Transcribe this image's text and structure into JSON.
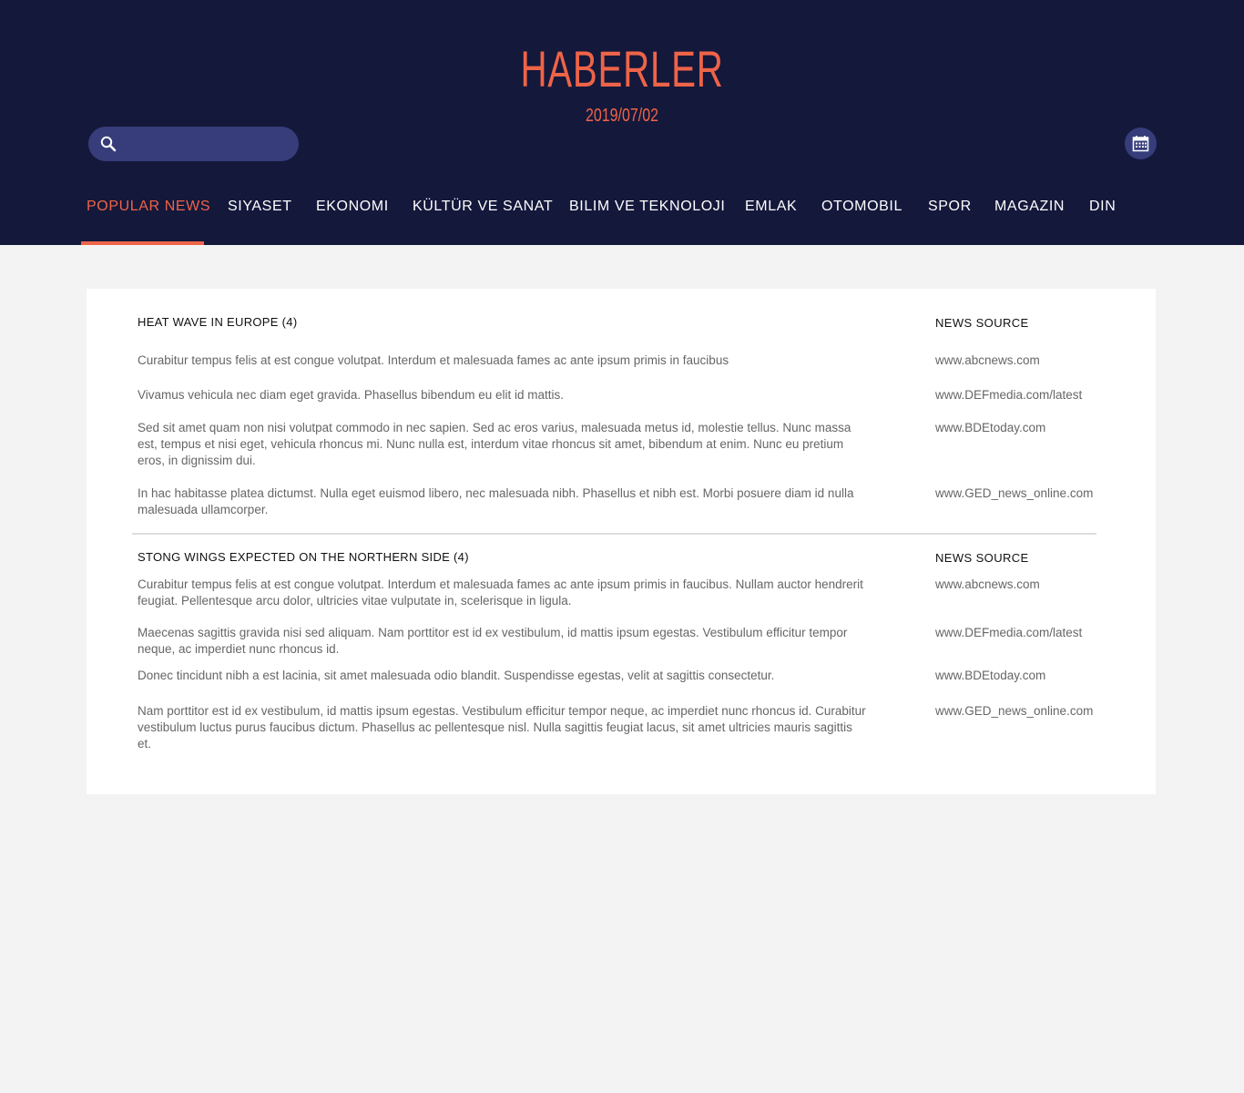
{
  "header": {
    "title": "HABERLER",
    "date": "2019/07/02",
    "search": {
      "value": "",
      "placeholder": ""
    }
  },
  "nav": {
    "items": [
      {
        "label": "POPULAR NEWS",
        "active": true
      },
      {
        "label": "SIYASET"
      },
      {
        "label": "EKONOMI"
      },
      {
        "label": "KÜLTÜR VE SANAT"
      },
      {
        "label": "BILIM VE TEKNOLOJI"
      },
      {
        "label": "EMLAK"
      },
      {
        "label": "OTOMOBIL"
      },
      {
        "label": "SPOR"
      },
      {
        "label": "MAGAZIN"
      },
      {
        "label": "DIN"
      }
    ]
  },
  "sections": [
    {
      "title": "HEAT WAVE IN EUROPE (4)",
      "source_header": "NEWS SOURCE",
      "items": [
        {
          "text": "Curabitur tempus felis at est congue volutpat. Interdum et malesuada fames ac ante ipsum primis in faucibus",
          "source": "www.abcnews.com"
        },
        {
          "text": "Vivamus vehicula nec diam eget gravida. Phasellus bibendum eu elit id mattis.",
          "source": "www.DEFmedia.com/latest"
        },
        {
          "text": "Sed sit amet quam non nisi volutpat commodo in nec sapien. Sed ac eros varius, malesuada metus id, molestie tellus. Nunc massa est, tempus et nisi eget, vehicula rhoncus mi. Nunc nulla est, interdum vitae rhoncus sit amet, bibendum at enim. Nunc eu pretium eros, in dignissim dui.",
          "source": "www.BDEtoday.com"
        },
        {
          "text": "In hac habitasse platea dictumst. Nulla eget euismod libero, nec malesuada nibh. Phasellus et nibh est. Morbi posuere diam id nulla malesuada ullamcorper.",
          "source": "www.GED_news_online.com"
        }
      ]
    },
    {
      "title": "STONG WINGS EXPECTED ON THE NORTHERN SIDE (4)",
      "source_header": "NEWS SOURCE",
      "items": [
        {
          "text": "Curabitur tempus felis at est congue volutpat. Interdum et malesuada fames ac ante ipsum primis in faucibus. Nullam auctor hendrerit feugiat. Pellentesque arcu dolor, ultricies vitae vulputate in, scelerisque in ligula.",
          "source": "www.abcnews.com"
        },
        {
          "text": "Maecenas sagittis gravida nisi sed aliquam. Nam porttitor est id ex vestibulum, id mattis ipsum egestas. Vestibulum efficitur tempor neque, ac imperdiet nunc rhoncus id.",
          "source": "www.DEFmedia.com/latest"
        },
        {
          "text": "Donec tincidunt nibh a est lacinia, sit amet malesuada odio blandit. Suspendisse egestas, velit at sagittis consectetur.",
          "source": "www.BDEtoday.com"
        },
        {
          "text": "Nam porttitor est id ex vestibulum, id mattis ipsum egestas. Vestibulum efficitur tempor neque, ac imperdiet nunc rhoncus id. Curabitur vestibulum luctus purus faucibus dictum. Phasellus ac pellentesque nisl. Nulla sagittis feugiat lacus, sit amet ultricies mauris sagittis et.",
          "source": "www.GED_news_online.com"
        }
      ]
    }
  ],
  "colors": {
    "header_bg": "#14183b",
    "accent": "#ee6448",
    "control_bg": "#363d7a",
    "page_bg": "#f3f3f3"
  },
  "icons": {
    "search": "search-icon",
    "calendar": "calendar-icon"
  }
}
